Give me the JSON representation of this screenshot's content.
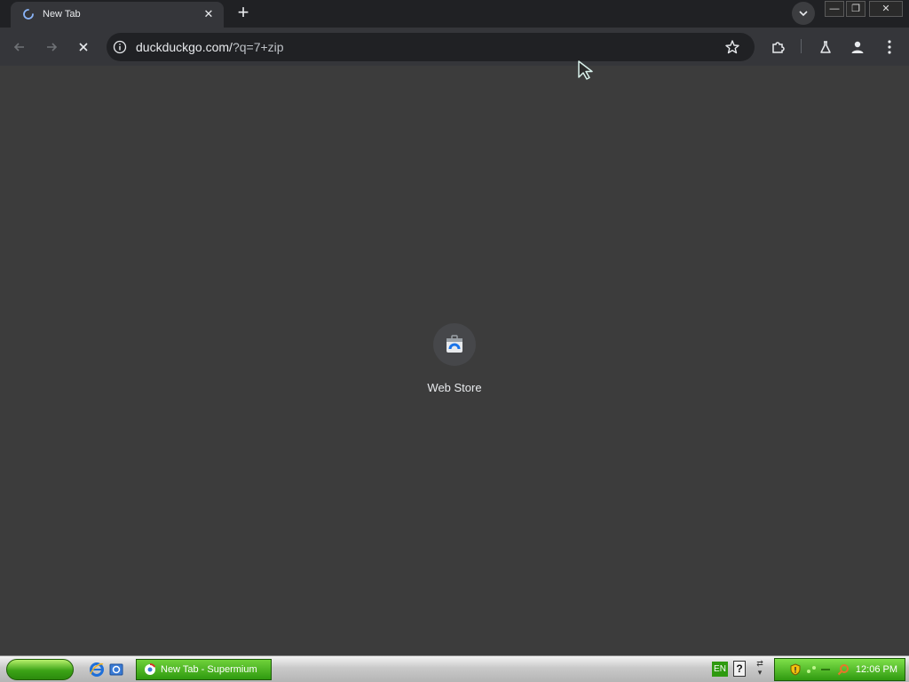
{
  "tab": {
    "title": "New Tab",
    "close_glyph": "✕"
  },
  "toolbar": {
    "url_host": "duckduckgo.com/",
    "url_path": "?q=7+zip"
  },
  "window_controls": {
    "minimize_glyph": "—",
    "restore_glyph": "❐",
    "close_glyph": "✕"
  },
  "new_tab_glyph": "+",
  "shortcuts": [
    {
      "label": "Web Store",
      "icon": "web-store-icon"
    }
  ],
  "taskbar": {
    "task_label": "New Tab - Supermium",
    "language": "EN",
    "help_glyph": "?",
    "clock": "12:06 PM"
  },
  "colors": {
    "background": "#3c3c3c",
    "tab_strip": "#202124",
    "toolbar": "#35363a",
    "taskbar_green": "#2f9a10"
  }
}
